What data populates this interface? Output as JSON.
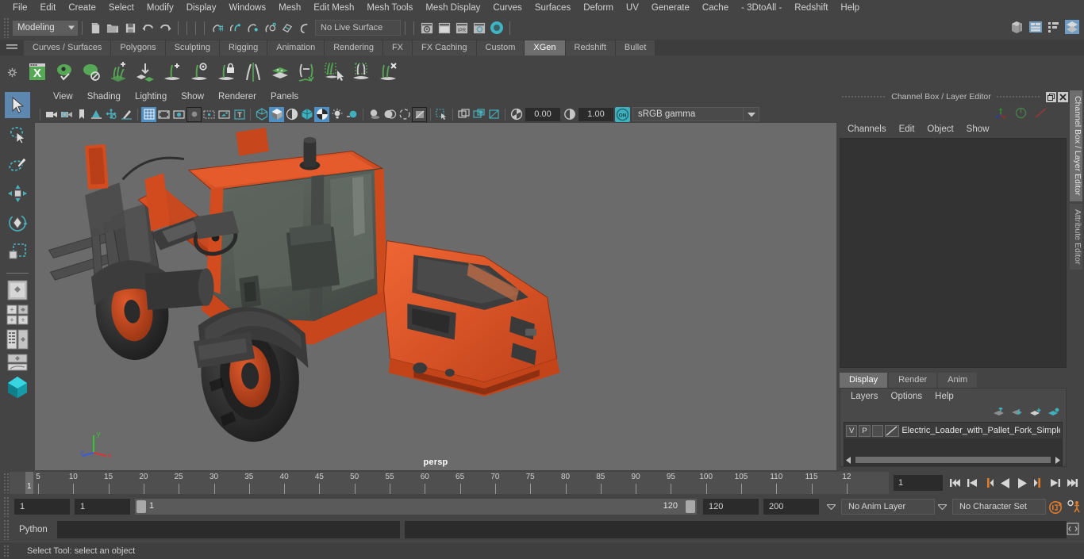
{
  "menubar": {
    "items": [
      "File",
      "Edit",
      "Create",
      "Select",
      "Modify",
      "Display",
      "Windows",
      "Mesh",
      "Edit Mesh",
      "Mesh Tools",
      "Mesh Display",
      "Curves",
      "Surfaces",
      "Deform",
      "UV",
      "Generate",
      "Cache",
      "- 3DtoAll -",
      "Redshift",
      "Help"
    ]
  },
  "statusline": {
    "menuset": "Modeling",
    "live_surface": "No Live Surface",
    "icons": [
      "new-scene-icon",
      "open-scene-icon",
      "save-scene-icon",
      "undo-icon",
      "redo-icon",
      "select-by-hierarchy-icon",
      "select-by-object-icon",
      "select-by-component-icon",
      "snap-to-grid-icon",
      "snap-to-curve-icon",
      "snap-to-point-icon",
      "snap-to-projected-center-icon",
      "snap-to-view-planes-icon",
      "make-live-icon",
      "render-current-frame-icon",
      "ipr-render-icon",
      "render-settings-icon",
      "hypershade-icon",
      "toggle-render-view-icon"
    ],
    "right_icons": [
      "show-hide-modeling-toolkit-icon",
      "show-hide-attribute-editor-icon",
      "show-hide-tool-settings-icon",
      "show-hide-channel-box-icon"
    ]
  },
  "shelf": {
    "tabs": [
      "Curves / Surfaces",
      "Polygons",
      "Sculpting",
      "Rigging",
      "Animation",
      "Rendering",
      "FX",
      "FX Caching",
      "Custom",
      "XGen",
      "Redshift",
      "Bullet"
    ],
    "active_tab": "XGen",
    "buttons": [
      {
        "name": "xgen-editor-icon",
        "label": "X"
      },
      {
        "name": "xgen-preview-icon",
        "label": ""
      },
      {
        "name": "xgen-disable-preview-icon",
        "label": ""
      },
      {
        "name": "xgen-add-description-icon",
        "label": ""
      },
      {
        "name": "xgen-import-collection-icon",
        "label": ""
      },
      {
        "name": "xgen-add-guide-icon",
        "label": "+"
      },
      {
        "name": "xgen-select-guide-icon",
        "label": ""
      },
      {
        "name": "xgen-lock-guide-icon",
        "label": ""
      },
      {
        "name": "xgen-mirror-guide-icon",
        "label": ""
      },
      {
        "name": "xgen-clumping-icon",
        "label": ""
      },
      {
        "name": "xgen-convert-to-interactive-icon",
        "label": ""
      },
      {
        "name": "xgen-groom-brush-icon",
        "label": ""
      },
      {
        "name": "xgen-region-mask-icon",
        "label": ""
      },
      {
        "name": "xgen-delete-guide-icon",
        "label": "X"
      }
    ]
  },
  "toolbox": {
    "tools": [
      {
        "name": "select-tool",
        "selected": true
      },
      {
        "name": "lasso-select-tool",
        "selected": false
      },
      {
        "name": "paint-select-tool",
        "selected": false
      },
      {
        "name": "move-tool",
        "selected": false
      },
      {
        "name": "rotate-tool",
        "selected": false
      },
      {
        "name": "scale-tool",
        "selected": false
      }
    ],
    "layouts": [
      "single-perspective-layout",
      "four-view-layout",
      "outliner-persp-layout",
      "persp-graph-layout",
      "hypershade-layout"
    ]
  },
  "viewport": {
    "menus": [
      "View",
      "Shading",
      "Lighting",
      "Show",
      "Renderer",
      "Panels"
    ],
    "camera_label": "persp",
    "exposure": "0.00",
    "gamma": "1.00",
    "color_space": "sRGB gamma",
    "color_management_toggle": "ON",
    "toolbar_icons": [
      "select-camera-icon",
      "camera-attributes-icon",
      "bookmark-icon",
      "image-plane-icon",
      "2d-pan-zoom-icon",
      "grease-pencil-icon",
      "grid-toggle-icon",
      "film-gate-icon",
      "resolution-gate-icon",
      "gate-mask-icon",
      "film-origin-icon",
      "xray-joints-icon",
      "text-overlay-icon",
      "wireframe-icon",
      "smooth-shade-all-icon",
      "smooth-shade-selected-icon",
      "shaded-wireframe-icon",
      "textured-icon",
      "use-default-lighting-icon",
      "use-all-lights-icon",
      "shadows-icon",
      "screen-space-ao-icon",
      "motion-blur-icon",
      "multisample-aa-icon",
      "isolate-select-icon",
      "xray-icon",
      "xray-active-components-icon",
      "exposure-icon",
      "gamma-icon"
    ],
    "axis_labels": {
      "x": "x",
      "y": "y",
      "z": "z"
    },
    "axis_colors": {
      "x": "#e03030",
      "y": "#35c535",
      "z": "#3a5adf"
    }
  },
  "model": {
    "name": "Electric Loader with Pallet Fork",
    "body_color": "#d94a1e",
    "dark_color": "#3c3c3c",
    "glass_color": "#575e58"
  },
  "channelbox": {
    "title": "Channel Box / Layer Editor",
    "window_buttons": [
      "restore-window-icon",
      "close-window-icon"
    ],
    "header_icons": [
      "manipulator-axis-icon",
      "speed-dial-icon",
      "alpha-blend-icon"
    ],
    "menus": [
      "Channels",
      "Edit",
      "Object",
      "Show"
    ],
    "content": ""
  },
  "layer_editor": {
    "tabs": [
      "Display",
      "Render",
      "Anim"
    ],
    "active_tab": "Display",
    "menus": [
      "Layers",
      "Options",
      "Help"
    ],
    "buttons": [
      "move-layer-up-icon",
      "move-layer-down-icon",
      "create-new-layer-icon",
      "create-layer-from-selected-icon"
    ],
    "layers": [
      {
        "visibility": "V",
        "playback": "P",
        "shading": "",
        "name": "Electric_Loader_with_Pallet_Fork_Simple_"
      }
    ]
  },
  "right_tabs": [
    {
      "label": "Channel Box / Layer Editor",
      "active": true
    },
    {
      "label": "Attribute Editor",
      "active": false
    }
  ],
  "timeline": {
    "labels": [
      "5",
      "10",
      "15",
      "20",
      "25",
      "30",
      "35",
      "40",
      "45",
      "50",
      "55",
      "60",
      "65",
      "70",
      "75",
      "80",
      "85",
      "90",
      "95",
      "100",
      "105",
      "110",
      "115",
      "12"
    ],
    "current_frame": "1",
    "current_frame_field": "1",
    "playback_buttons": [
      "go-to-start-icon",
      "step-back-keyframe-icon",
      "step-back-frame-icon",
      "play-backwards-icon",
      "play-forwards-icon",
      "step-forward-frame-icon",
      "step-forward-keyframe-icon",
      "go-to-end-icon"
    ]
  },
  "range_slider": {
    "anim_start": "1",
    "range_start": "1",
    "bar_start": "1",
    "bar_end": "120",
    "range_end": "120",
    "anim_end": "200",
    "anim_layer": "No Anim Layer",
    "character_set": "No Character Set",
    "right_icons": [
      "auto-keyframe-icon",
      "animation-preferences-icon"
    ]
  },
  "command_line": {
    "language": "Python",
    "input_value": "",
    "output_value": "",
    "expand_icon": "script-editor-icon"
  },
  "help_line": {
    "text": "Select Tool: select an object"
  },
  "colors": {
    "accent_blue": "#4f90c4",
    "shelf_green": "#5aa45a",
    "orange": "#e07b2a",
    "teal": "#49b0bd"
  }
}
